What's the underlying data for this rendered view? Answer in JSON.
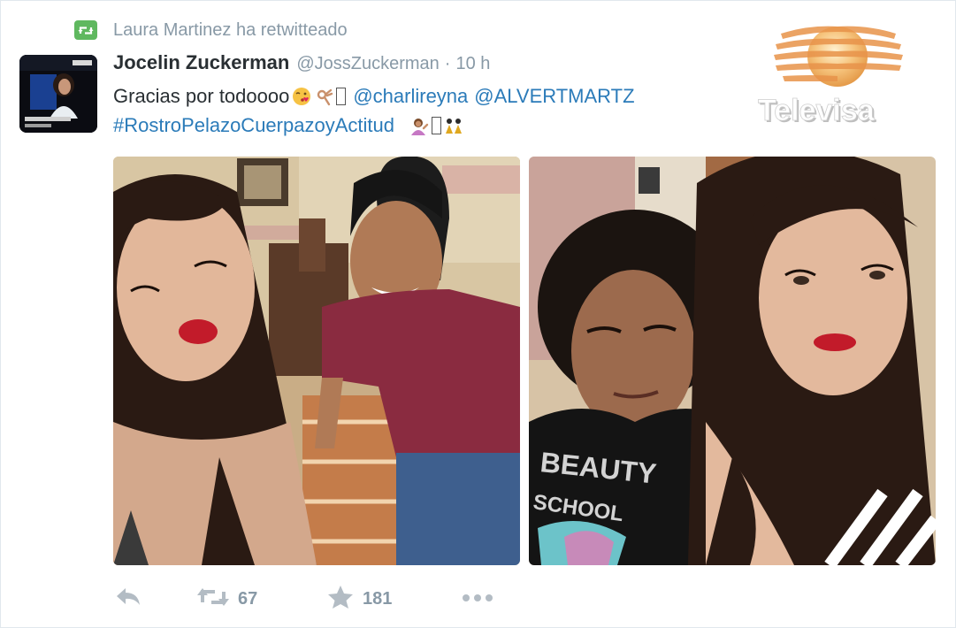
{
  "context": {
    "retweeted_by": "Laura Martinez ha retwitteado",
    "icon": "retweet-badge-icon"
  },
  "tweet": {
    "fullname": "Jocelin Zuckerman",
    "handle": "@JossZuckerman",
    "separator": "·",
    "time": "10 h",
    "text_start": "Gracias por todoooo",
    "mention_1": "@charlireyna",
    "mention_2": "@ALVERTMARTZ",
    "hashtag": "#RostroPelazoCuerpazoyActitud"
  },
  "watermark": {
    "text": "Televisa"
  },
  "actions": {
    "retweet_count": "67",
    "favorite_count": "181",
    "icons": [
      "reply-icon",
      "retweet-icon",
      "favorite-star-icon",
      "more-dots-icon"
    ]
  },
  "colors": {
    "link": "#2b7bb9",
    "muted": "#8899a6",
    "retweet_green": "#5fb85f",
    "text": "#292f33"
  }
}
